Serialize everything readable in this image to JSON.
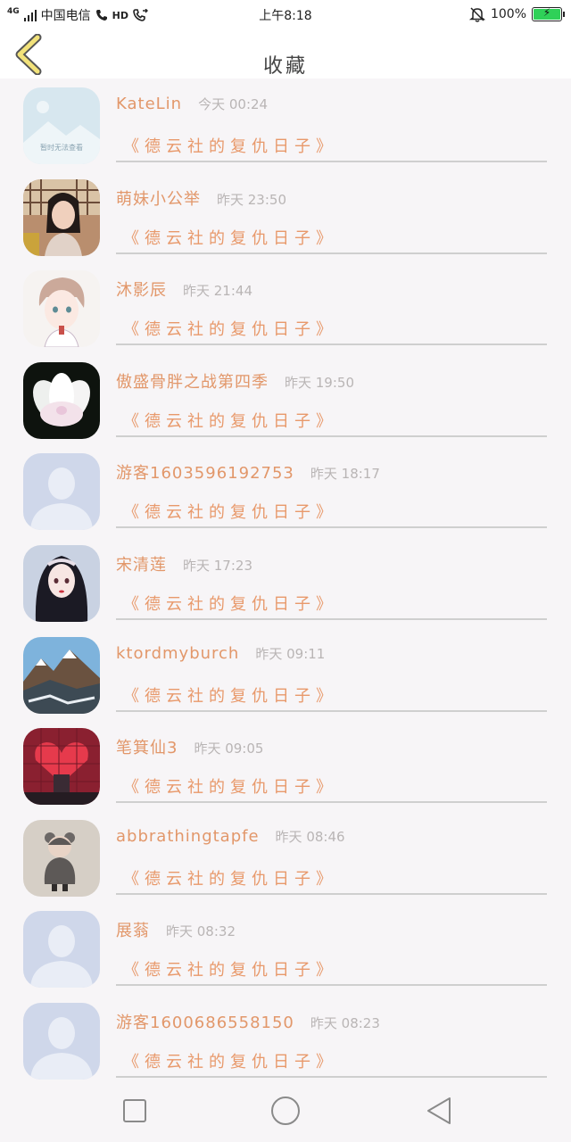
{
  "status_bar": {
    "network": "4G",
    "carrier": "中国电信",
    "hd": "HD",
    "time": "上午8:18",
    "battery": "100%",
    "battery_level": 1.0
  },
  "header": {
    "title": "收藏",
    "back_icon": "chevron-left-icon",
    "accent_color": "#f2e27a"
  },
  "items": [
    {
      "name": "KateLin",
      "time": "今天 00:24",
      "work": "《德云社的复仇日子》",
      "avatar": "placeholder-image",
      "avatar_caption": "暂时无法查看"
    },
    {
      "name": "萌妹小公举",
      "time": "昨天 23:50",
      "work": "《德云社的复仇日子》",
      "avatar": "girl-photo"
    },
    {
      "name": "沐影辰",
      "time": "昨天 21:44",
      "work": "《德云社的复仇日子》",
      "avatar": "anime-boy"
    },
    {
      "name": "傲盛骨胖之战第四季",
      "time": "昨天 19:50",
      "work": "《德云社的复仇日子》",
      "avatar": "lotus-flower"
    },
    {
      "name": "游客1603596192753",
      "time": "昨天 18:17",
      "work": "《德云社的复仇日子》",
      "avatar": "default-user"
    },
    {
      "name": "宋清莲",
      "time": "昨天 17:23",
      "work": "《德云社的复仇日子》",
      "avatar": "anime-girl"
    },
    {
      "name": "ktordmyburch",
      "time": "昨天 09:11",
      "work": "《德云社的复仇日子》",
      "avatar": "mountain-landscape"
    },
    {
      "name": "笔箕仙3",
      "time": "昨天 09:05",
      "work": "《德云社的复仇日子》",
      "avatar": "heart-wall"
    },
    {
      "name": "abbrathingtapfe",
      "time": "昨天 08:46",
      "work": "《德云社的复仇日子》",
      "avatar": "baby-photo"
    },
    {
      "name": "展蓊",
      "time": "昨天 08:32",
      "work": "《德云社的复仇日子》",
      "avatar": "default-user"
    },
    {
      "name": "游客1600686558150",
      "time": "昨天 08:23",
      "work": "《德云社的复仇日子》",
      "avatar": "default-user"
    }
  ],
  "nav": {
    "recent_icon": "square-icon",
    "home_icon": "circle-icon",
    "back_icon": "triangle-back-icon"
  }
}
